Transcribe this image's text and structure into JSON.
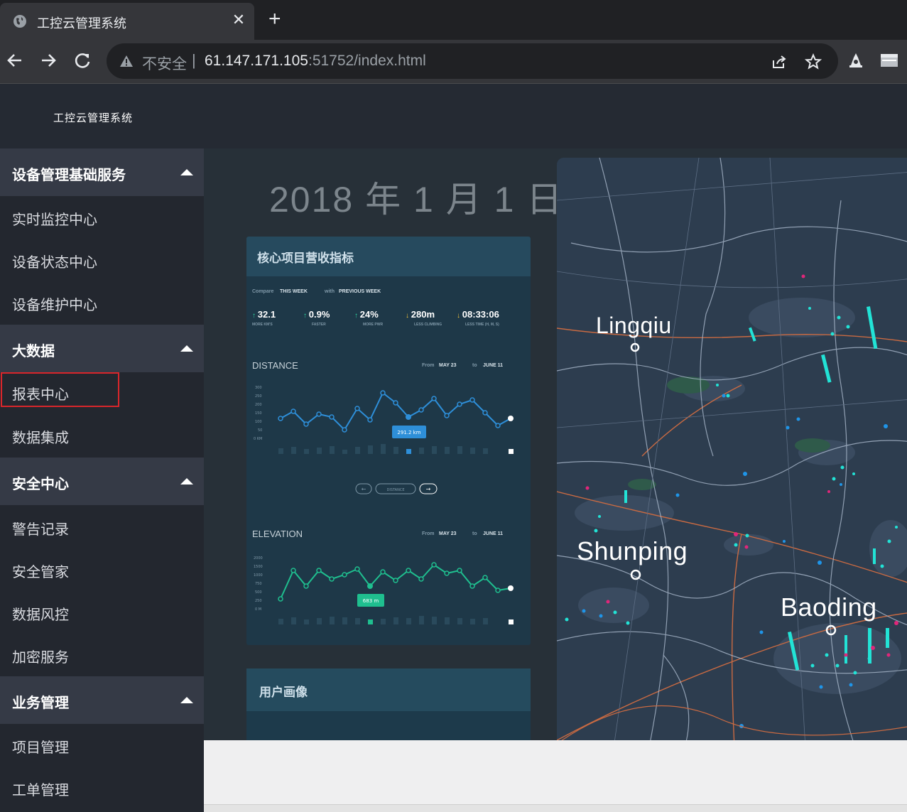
{
  "browser": {
    "tab_title": "工控云管理系统",
    "close_glyph": "✕",
    "new_tab_glyph": "+",
    "security_label": "不安全",
    "separator": "|",
    "url_host": "61.147.171.105",
    "url_rest": ":51752/index.html"
  },
  "app": {
    "title": "工控云管理系统"
  },
  "sidebar": {
    "groups": [
      {
        "label": "设备管理基础服务",
        "items": [
          "实时监控中心",
          "设备状态中心",
          "设备维护中心"
        ]
      },
      {
        "label": "大数据",
        "items": [
          "报表中心",
          "数据集成"
        ]
      },
      {
        "label": "安全中心",
        "items": [
          "警告记录",
          "安全管家",
          "数据风控",
          "加密服务"
        ]
      },
      {
        "label": "业务管理",
        "items": [
          "项目管理",
          "工单管理"
        ]
      }
    ],
    "selected_item": "报表中心"
  },
  "dashboard": {
    "date_title": "2018 年 1 月 1 日",
    "card1": {
      "title": "核心项目营收指标",
      "compare_label": "Compare",
      "this_week": "THIS WEEK",
      "with_label": "with",
      "previous_week": "PREVIOUS WEEK",
      "stats": [
        {
          "value": "32.1",
          "caption": "MORE KM'S",
          "dir": "up"
        },
        {
          "value": "0.9%",
          "caption": "FASTER",
          "dir": "up"
        },
        {
          "value": "24%",
          "caption": "MORE PWR",
          "dir": "up"
        },
        {
          "value": "280m",
          "caption": "LESS CLIMBING",
          "dir": "down"
        },
        {
          "value": "08:33:06",
          "caption": "LESS TIME (H, M, S)",
          "dir": "down"
        }
      ],
      "distance_label": "DISTANCE",
      "elevation_label": "ELEVATION",
      "from_label": "From",
      "to_label": "to",
      "range_from": "MAY 23",
      "range_to": "JUNE 11",
      "distance_tooltip": "291.2 km",
      "elevation_tooltip": "683 m",
      "pager_label": "DISTANCE",
      "distance_y_ticks": [
        "300",
        "250",
        "200",
        "150",
        "100",
        "50",
        "0 KM"
      ],
      "elevation_y_ticks": [
        "2000",
        "1500",
        "1000",
        "750",
        "500",
        "250",
        "0 M"
      ]
    },
    "card2": {
      "title": "用户画像"
    },
    "map": {
      "cities": [
        "Lingqiu",
        "Shunping",
        "Baoding"
      ]
    }
  },
  "colors": {
    "sidebar_bg": "#23272f",
    "group_header_bg": "#353a46",
    "selected_border": "#d9262b",
    "distance_line": "#2e8fd9",
    "elevation_line": "#1fbf8f",
    "map_bar_cyan": "#22e3d6",
    "map_dot_pink": "#e0267a"
  }
}
